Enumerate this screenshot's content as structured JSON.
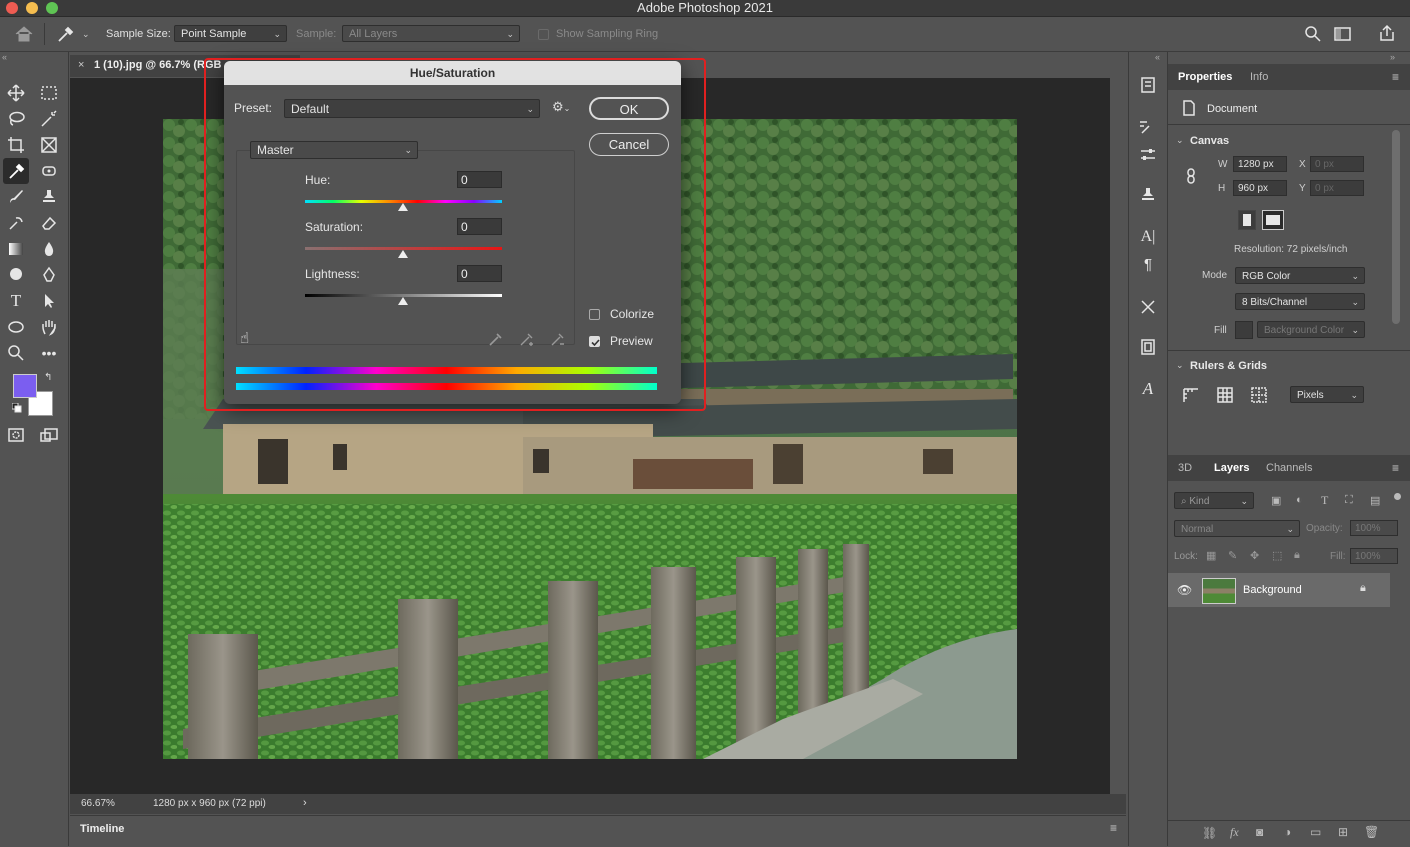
{
  "app": {
    "title": "Adobe Photoshop 2021"
  },
  "options_bar": {
    "sample_size_label": "Sample Size:",
    "sample_size_value": "Point Sample",
    "sample_label": "Sample:",
    "sample_value": "All Layers",
    "sampling_ring_label": "Show Sampling Ring"
  },
  "document": {
    "tab_label": "1 (10).jpg @ 66.7% (RGB",
    "zoom": "66.67%",
    "dimensions": "1280 px x 960 px (72 ppi)"
  },
  "timeline": {
    "label": "Timeline"
  },
  "colors": {
    "foreground": "#7b5ef0",
    "background": "#ffffff",
    "highlight": "#e02020"
  },
  "dialog": {
    "title": "Hue/Saturation",
    "preset_label": "Preset:",
    "preset_value": "Default",
    "ok_label": "OK",
    "cancel_label": "Cancel",
    "channel_value": "Master",
    "hue_label": "Hue:",
    "hue_value": "0",
    "saturation_label": "Saturation:",
    "saturation_value": "0",
    "lightness_label": "Lightness:",
    "lightness_value": "0",
    "colorize_label": "Colorize",
    "colorize_checked": false,
    "preview_label": "Preview",
    "preview_checked": true
  },
  "properties": {
    "tab_properties": "Properties",
    "tab_info": "Info",
    "document_label": "Document",
    "canvas_section": "Canvas",
    "w_label": "W",
    "w_value": "1280 px",
    "h_label": "H",
    "h_value": "960 px",
    "x_label": "X",
    "x_placeholder": "0 px",
    "y_label": "Y",
    "y_placeholder": "0 px",
    "resolution": "Resolution: 72 pixels/inch",
    "mode_label": "Mode",
    "mode_value": "RGB Color",
    "bits_value": "8 Bits/Channel",
    "fill_label": "Fill",
    "fill_value": "Background Color",
    "rulers_section": "Rulers & Grids",
    "units_value": "Pixels"
  },
  "layers_panel": {
    "tab_3d": "3D",
    "tab_layers": "Layers",
    "tab_channels": "Channels",
    "kind_placeholder": "Kind",
    "blend_mode": "Normal",
    "opacity_label": "Opacity:",
    "opacity_value": "100%",
    "lock_label": "Lock:",
    "fill_label": "Fill:",
    "fill_value": "100%",
    "layers": [
      {
        "name": "Background",
        "visible": true,
        "locked": true
      }
    ]
  }
}
